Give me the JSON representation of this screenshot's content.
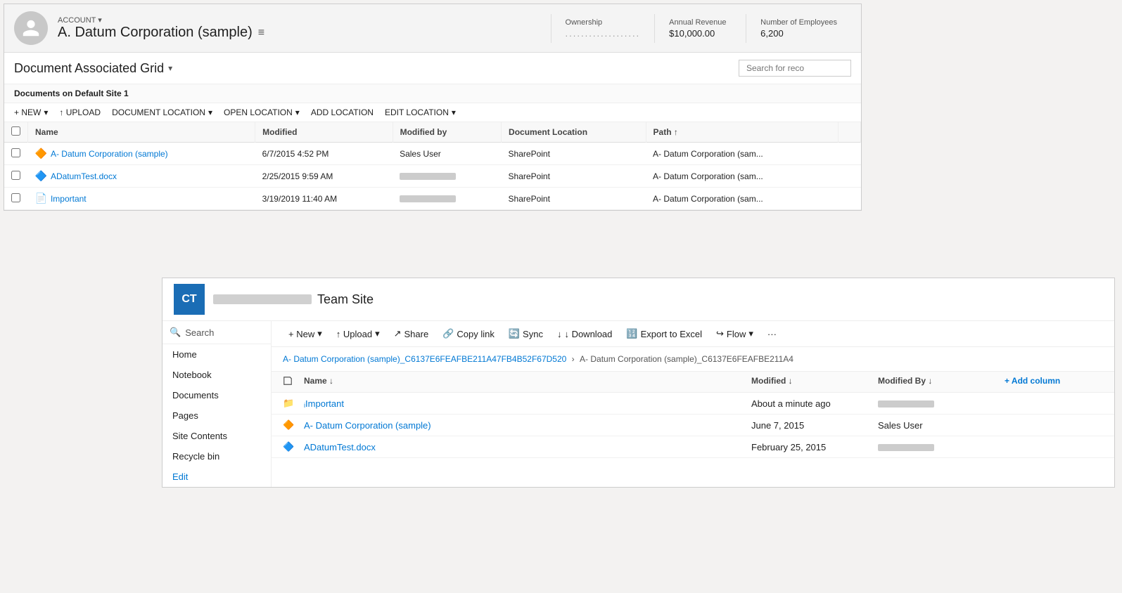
{
  "crm": {
    "account_label": "ACCOUNT",
    "account_name": "A. Datum Corporation (sample)",
    "fields": [
      {
        "label": "Ownership",
        "value": "...................",
        "is_dots": true
      },
      {
        "label": "Annual Revenue",
        "value": "$10,000.00",
        "is_dots": false
      },
      {
        "label": "Number of Employees",
        "value": "6,200",
        "is_dots": false
      }
    ],
    "grid_title": "Document Associated Grid",
    "search_placeholder": "Search for reco",
    "location_bar": "Documents on Default Site 1",
    "toolbar": {
      "new": "+ NEW",
      "upload": "↑ UPLOAD",
      "document_location": "DOCUMENT LOCATION",
      "open_location": "OPEN LOCATION",
      "add_location": "ADD LOCATION",
      "edit_location": "EDIT LOCATION"
    },
    "table": {
      "columns": [
        "Name",
        "Modified",
        "Modified by",
        "Document Location",
        "Path ↑"
      ],
      "rows": [
        {
          "icon": "📄",
          "icon_color": "#d65c1e",
          "name": "A- Datum Corporation (sample)",
          "modified": "6/7/2015 4:52 PM",
          "modified_by": "Sales User",
          "doc_location": "SharePoint",
          "path": "A- Datum Corporation (sam...",
          "redacted": false
        },
        {
          "icon": "📄",
          "icon_color": "#1e4db8",
          "name": "ADatumTest.docx",
          "modified": "2/25/2015 9:59 AM",
          "modified_by": "",
          "doc_location": "SharePoint",
          "path": "A- Datum Corporation (sam...",
          "redacted": true
        },
        {
          "icon": "📄",
          "icon_color": "#555",
          "name": "Important",
          "modified": "3/19/2019 11:40 AM",
          "modified_by": "",
          "doc_location": "SharePoint",
          "path": "A- Datum Corporation (sam...",
          "redacted": true
        }
      ]
    }
  },
  "sharepoint": {
    "logo_initials": "CT",
    "site_name": "Team Site",
    "sidebar": {
      "search_label": "Search",
      "items": [
        "Home",
        "Notebook",
        "Documents",
        "Pages",
        "Site Contents",
        "Recycle bin",
        "Edit"
      ]
    },
    "command_bar": {
      "new": "+ New",
      "upload": "↑ Upload",
      "share": "Share",
      "copy_link": "Copy link",
      "sync": "Sync",
      "download": "↓ Download",
      "export_to_excel": "Export to Excel",
      "flow": "Flow",
      "more": "···"
    },
    "breadcrumb": {
      "part1": "A- Datum Corporation (sample)_C6137E6FEAFBE211A47FB4B52F67D520",
      "sep": ">",
      "part2": "A- Datum Corporation (sample)_C6137E6FEAFBE211A4"
    },
    "table": {
      "columns": [
        "Name ↓",
        "Modified ↓",
        "Modified By ↓",
        "+ Add column"
      ],
      "rows": [
        {
          "icon": "📁",
          "name": "Important",
          "modified": "About a minute ago",
          "modified_by": "",
          "redacted": true
        },
        {
          "icon": "📄",
          "icon_color": "#d65c1e",
          "name": "A- Datum Corporation (sample)",
          "modified": "June 7, 2015",
          "modified_by": "Sales User",
          "redacted": false
        },
        {
          "icon": "📄",
          "icon_color": "#1e4db8",
          "name": "ADatumTest.docx",
          "modified": "February 25, 2015",
          "modified_by": "",
          "redacted": true
        }
      ]
    }
  }
}
